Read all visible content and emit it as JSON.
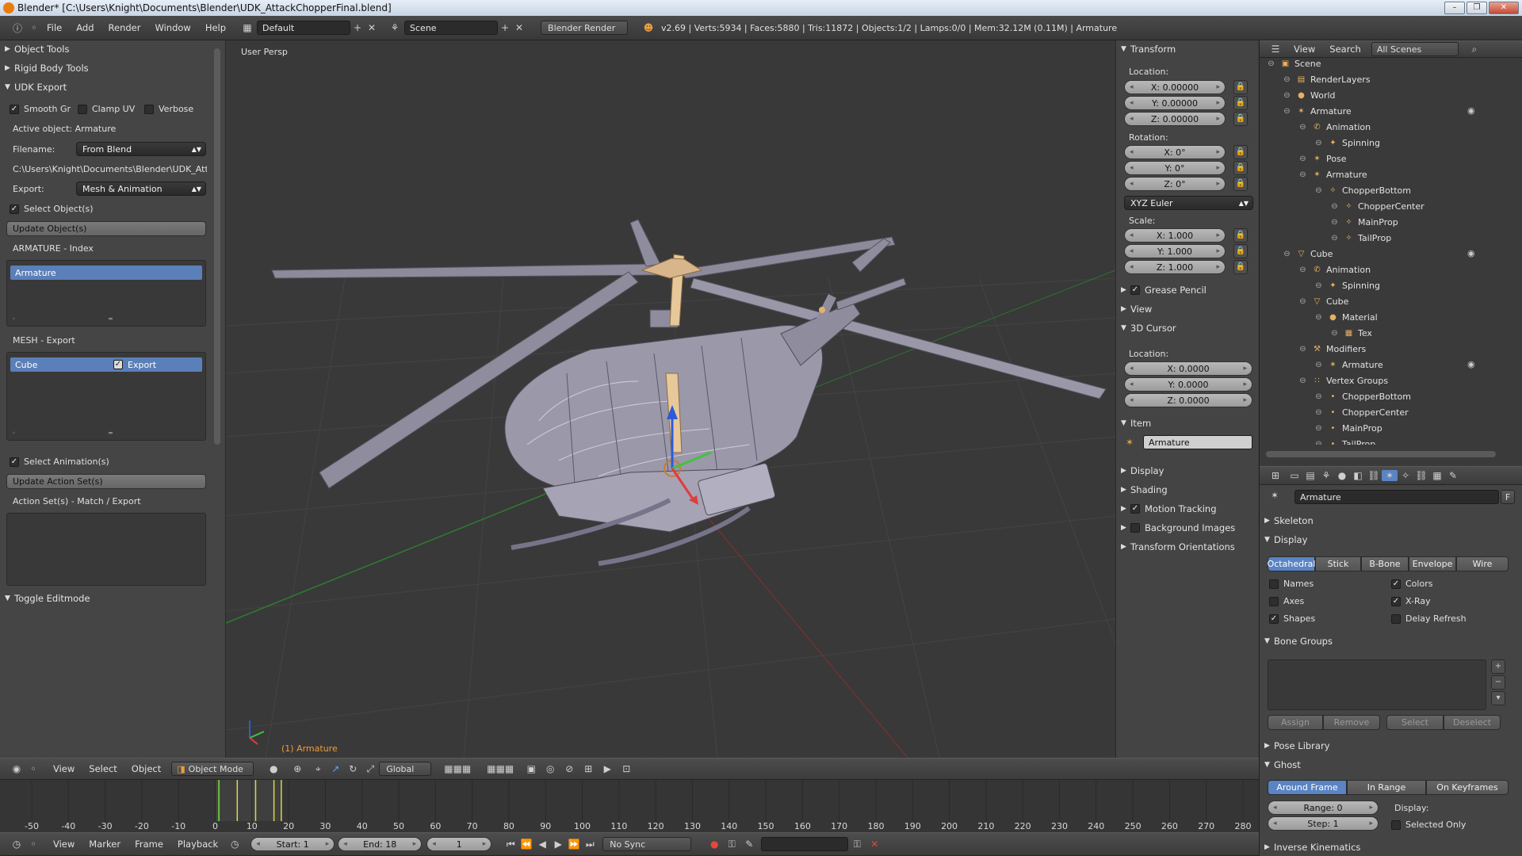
{
  "window": {
    "title": "Blender* [C:\\Users\\Knight\\Documents\\Blender\\UDK_AttackChopperFinal.blend]",
    "minimize": "–",
    "restore": "❐",
    "close": "✕"
  },
  "infobar": {
    "menus": [
      "File",
      "Add",
      "Render",
      "Window",
      "Help"
    ],
    "screen_layout": "Default",
    "scene": "Scene",
    "render_engine": "Blender Render",
    "stats": "v2.69 | Verts:5934 | Faces:5880 | Tris:11872 | Objects:1/2 | Lamps:0/0 | Mem:32.12M (0.11M) | Armature"
  },
  "left_panel": {
    "object_tools": "Object Tools",
    "rigid_body_tools": "Rigid Body Tools",
    "udk_export": "UDK Export",
    "smooth_gr": "Smooth Gr",
    "clamp_uv": "Clamp UV",
    "verbose": "Verbose",
    "active_object": "Active object: Armature",
    "filename_label": "Filename:",
    "filename_value": "From Blend",
    "path": "C:\\Users\\Knight\\Documents\\Blender\\UDK_Attack",
    "export_label": "Export:",
    "export_value": "Mesh & Animation",
    "select_objects": "Select Object(s)",
    "update_objects": "Update Object(s)",
    "armature_index": "ARMATURE - Index",
    "armature_item": "Armature",
    "mesh_export": "MESH - Export",
    "mesh_item": "Cube",
    "mesh_export_check": "Export",
    "select_animations": "Select Animation(s)",
    "update_action_sets": "Update Action Set(s)",
    "action_sets": "Action Set(s) - Match / Export",
    "toggle_editmode": "Toggle Editmode"
  },
  "viewport": {
    "label": "User Persp",
    "active_object": "(1) Armature",
    "menus": [
      "View",
      "Select",
      "Object"
    ],
    "mode": "Object Mode",
    "orientation": "Global"
  },
  "properties_n": {
    "transform": "Transform",
    "location": "Location:",
    "loc": [
      "X: 0.00000",
      "Y: 0.00000",
      "Z: 0.00000"
    ],
    "rotation": "Rotation:",
    "rot": [
      "X: 0°",
      "Y: 0°",
      "Z: 0°"
    ],
    "rotation_mode": "XYZ Euler",
    "scale": "Scale:",
    "scl": [
      "X: 1.000",
      "Y: 1.000",
      "Z: 1.000"
    ],
    "grease_pencil": "Grease Pencil",
    "view": "View",
    "cursor": "3D Cursor",
    "cursor_location": "Location:",
    "cur": [
      "X: 0.0000",
      "Y: 0.0000",
      "Z: 0.0000"
    ],
    "item": "Item",
    "item_name": "Armature",
    "display": "Display",
    "shading": "Shading",
    "motion_tracking": "Motion Tracking",
    "background_images": "Background Images",
    "transform_orientations": "Transform Orientations"
  },
  "outliner": {
    "menus": [
      "View",
      "Search"
    ],
    "filter": "All Scenes",
    "items": [
      {
        "label": "Scene",
        "depth": 0,
        "icon": "▣"
      },
      {
        "label": "RenderLayers",
        "depth": 1,
        "icon": "▤"
      },
      {
        "label": "World",
        "depth": 1,
        "icon": "●"
      },
      {
        "label": "Armature",
        "depth": 1,
        "icon": "✶"
      },
      {
        "label": "Animation",
        "depth": 2,
        "icon": "✆"
      },
      {
        "label": "Spinning",
        "depth": 3,
        "icon": "✦"
      },
      {
        "label": "Pose",
        "depth": 2,
        "icon": "✶"
      },
      {
        "label": "Armature",
        "depth": 2,
        "icon": "✶"
      },
      {
        "label": "ChopperBottom",
        "depth": 3,
        "icon": "✧"
      },
      {
        "label": "ChopperCenter",
        "depth": 4,
        "icon": "✧"
      },
      {
        "label": "MainProp",
        "depth": 4,
        "icon": "✧"
      },
      {
        "label": "TailProp",
        "depth": 4,
        "icon": "✧"
      },
      {
        "label": "Cube",
        "depth": 1,
        "icon": "▽"
      },
      {
        "label": "Animation",
        "depth": 2,
        "icon": "✆"
      },
      {
        "label": "Spinning",
        "depth": 3,
        "icon": "✦"
      },
      {
        "label": "Cube",
        "depth": 2,
        "icon": "▽"
      },
      {
        "label": "Material",
        "depth": 3,
        "icon": "●"
      },
      {
        "label": "Tex",
        "depth": 4,
        "icon": "▦"
      },
      {
        "label": "Modifiers",
        "depth": 2,
        "icon": "⚒"
      },
      {
        "label": "Armature",
        "depth": 3,
        "icon": "✶"
      },
      {
        "label": "Vertex Groups",
        "depth": 2,
        "icon": "∷"
      },
      {
        "label": "ChopperBottom",
        "depth": 3,
        "icon": "•"
      },
      {
        "label": "ChopperCenter",
        "depth": 3,
        "icon": "•"
      },
      {
        "label": "MainProp",
        "depth": 3,
        "icon": "•"
      },
      {
        "label": "TailProp",
        "depth": 3,
        "icon": "•"
      }
    ]
  },
  "properties": {
    "datablock": "Armature",
    "fake_user": "F",
    "skeleton": "Skeleton",
    "display": "Display",
    "display_tabs": [
      "Octahedral",
      "Stick",
      "B-Bone",
      "Envelope",
      "Wire"
    ],
    "names": "Names",
    "axes": "Axes",
    "shapes": "Shapes",
    "colors": "Colors",
    "xray": "X-Ray",
    "delay_refresh": "Delay Refresh",
    "bone_groups": "Bone Groups",
    "bg_buttons": [
      "Assign",
      "Remove",
      "Select",
      "Deselect"
    ],
    "pose_library": "Pose Library",
    "ghost": "Ghost",
    "ghost_tabs": [
      "Around Frame",
      "In Range",
      "On Keyframes"
    ],
    "range": "Range: 0",
    "step": "Step: 1",
    "display_label": "Display:",
    "selected_only": "Selected Only",
    "inverse_kinematics": "Inverse Kinematics"
  },
  "timeline": {
    "ticks": [
      "-50",
      "-40",
      "-30",
      "-20",
      "-10",
      "0",
      "10",
      "20",
      "30",
      "40",
      "50",
      "60",
      "70",
      "80",
      "90",
      "100",
      "110",
      "120",
      "130",
      "140",
      "150",
      "160",
      "170",
      "180",
      "190",
      "200",
      "210",
      "220",
      "230",
      "240",
      "250",
      "260",
      "270",
      "280"
    ],
    "menus": [
      "View",
      "Marker",
      "Frame",
      "Playback"
    ],
    "start": "Start: 1",
    "end": "End: 18",
    "current": "1",
    "sync": "No Sync"
  }
}
